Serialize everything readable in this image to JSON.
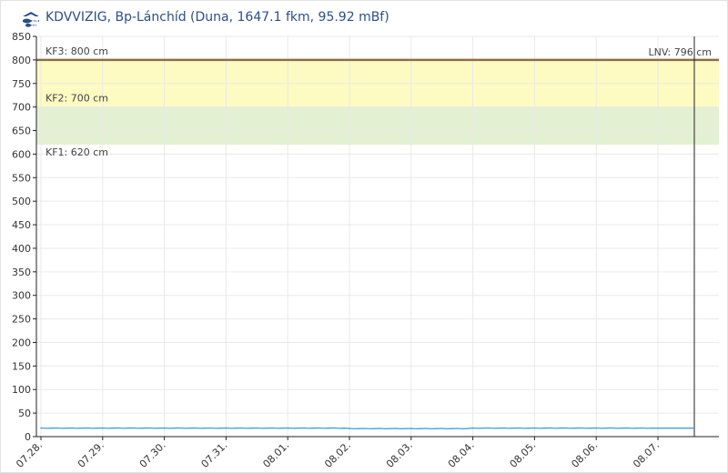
{
  "header": {
    "title": "KDVVIZIG, Bp-Lánchíd (Duna, 1647.1 fkm, 95.92 mBf)",
    "logo_icon": "wave-logo-icon"
  },
  "colors": {
    "band_kf3": "#fdfbc2",
    "band_kf2": "#e4f0d2",
    "kf3_line": "#8b6f45",
    "series_line": "#3aa0d8",
    "grid": "#e9e9e9",
    "title": "#2a4f8a"
  },
  "chart_data": {
    "type": "line",
    "title": "KDVVIZIG, Bp-Lánchíd (Duna, 1647.1 fkm, 95.92 mBf)",
    "ylim": [
      0,
      850
    ],
    "yticks": [
      0,
      50,
      100,
      150,
      200,
      250,
      300,
      350,
      400,
      450,
      500,
      550,
      600,
      650,
      700,
      750,
      800,
      850
    ],
    "xticks": [
      "07.28.",
      "07.29.",
      "07.30.",
      "07.31.",
      "08.01.",
      "08.02.",
      "08.03.",
      "08.04.",
      "08.05.",
      "08.06.",
      "08.07."
    ],
    "grid": true,
    "thresholds": [
      {
        "name": "KF3",
        "value": 800,
        "label": "KF3: 800 cm"
      },
      {
        "name": "KF2",
        "value": 700,
        "label": "KF2: 700 cm"
      },
      {
        "name": "KF1",
        "value": 620,
        "label": "KF1: 620 cm"
      }
    ],
    "lnv": {
      "label": "LNV: 796 cm",
      "value": 796,
      "date": "08.07."
    },
    "series": [
      {
        "x": [
          "07.28.",
          "07.29.",
          "07.30.",
          "07.31.",
          "08.01.",
          "08.02.",
          "08.03.",
          "08.04.",
          "08.05.",
          "08.06.",
          "08.07."
        ],
        "values": [
          18,
          18,
          18,
          18,
          18,
          17,
          17,
          18,
          18,
          18,
          18
        ]
      }
    ]
  }
}
